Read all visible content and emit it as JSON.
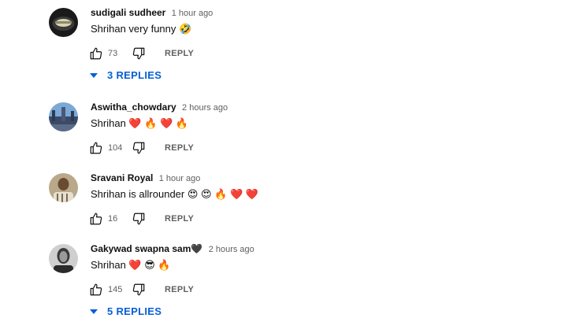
{
  "comments": [
    {
      "author": "sudigali sudheer",
      "time": "1 hour ago",
      "text": "Shrihan very funny 🤣",
      "likes": "73",
      "reply_label": "REPLY",
      "replies_label": "3 REPLIES",
      "avatar": "avatar-dark-circle"
    },
    {
      "author": "Aswitha_chowdary",
      "time": "2 hours ago",
      "text": "Shrihan ❤️ 🔥 ❤️ 🔥",
      "likes": "104",
      "reply_label": "REPLY",
      "avatar": "avatar-city-photo"
    },
    {
      "author": "Sravani Royal",
      "time": "1 hour ago",
      "text": "Shrihan is allrounder 😍 😍 🔥 ❤️ ❤️",
      "likes": "16",
      "reply_label": "REPLY",
      "avatar": "avatar-person-photo"
    },
    {
      "author": "Gakywad swapna sam🖤",
      "time": "2 hours ago",
      "text": "Shrihan ❤️ 😎 🔥",
      "likes": "145",
      "reply_label": "REPLY",
      "replies_label": "5 REPLIES",
      "avatar": "avatar-bw-portrait"
    }
  ],
  "colors": {
    "link": "#065fd4",
    "meta": "#606060",
    "text": "#0f0f0f"
  },
  "icons": {
    "like": "thumbs-up-icon",
    "dislike": "thumbs-down-icon",
    "expand": "caret-down-icon"
  }
}
